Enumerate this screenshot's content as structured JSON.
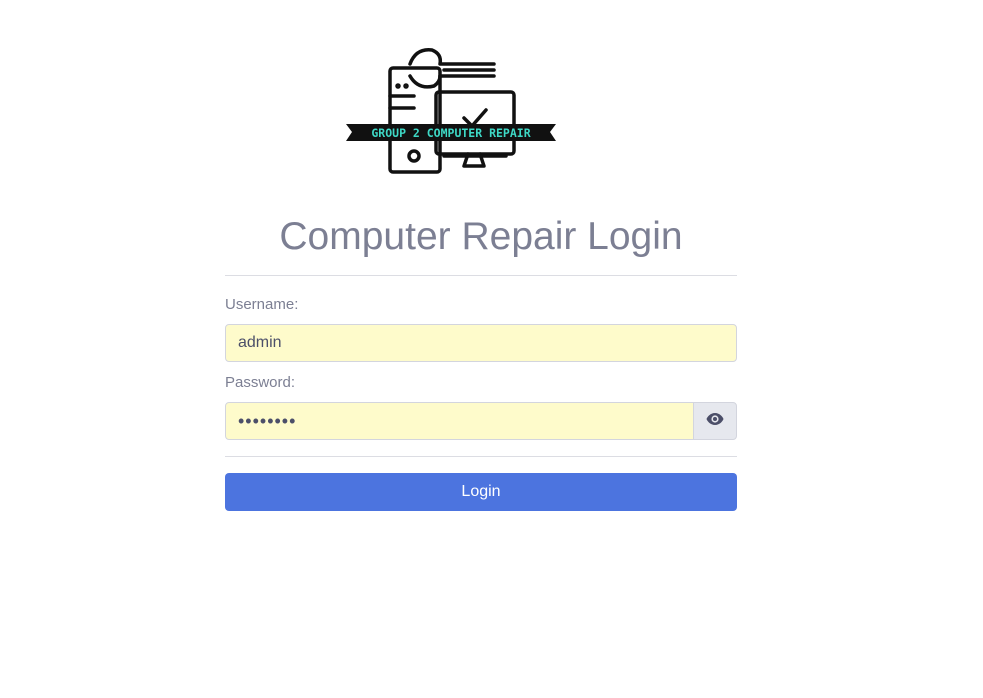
{
  "logo": {
    "banner_text": "GROUP 2 COMPUTER REPAIR",
    "banner_color": "#3ed9c6"
  },
  "header": {
    "title": "Computer Repair Login"
  },
  "form": {
    "username_label": "Username:",
    "username_value": "admin",
    "password_label": "Password:",
    "password_value": "••••••••",
    "show_password_icon": "eye-icon",
    "login_label": "Login"
  },
  "colors": {
    "accent": "#4c74df",
    "autofill_bg": "#fefbcb",
    "text_muted": "#7c7f93"
  }
}
